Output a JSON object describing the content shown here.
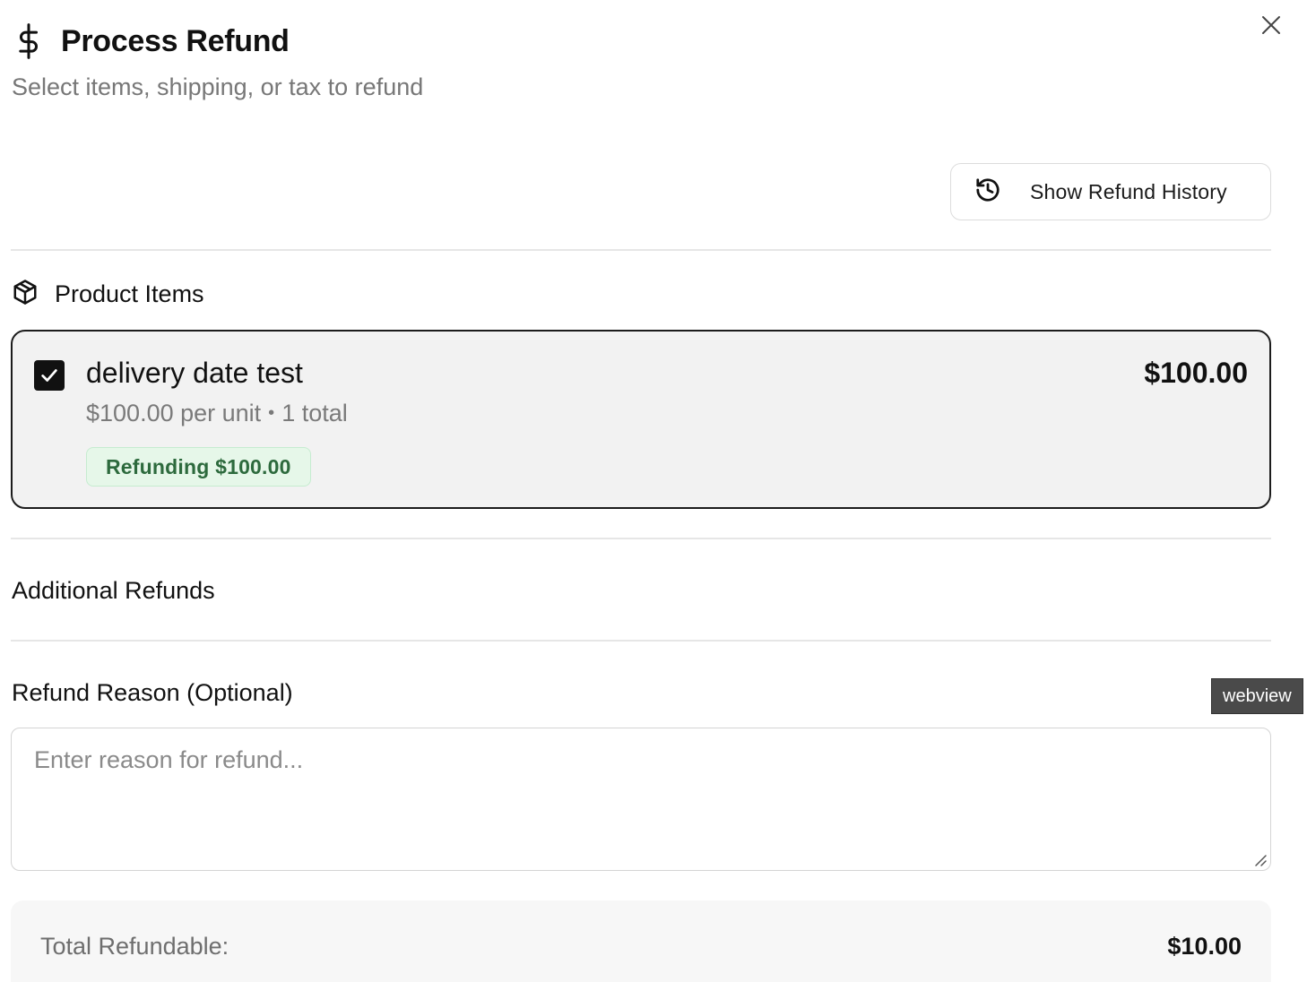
{
  "header": {
    "title": "Process Refund",
    "subtitle": "Select items, shipping, or tax to refund",
    "icon": "dollar-icon",
    "close_icon": "close-icon"
  },
  "history_button": {
    "label": "Show Refund History",
    "icon": "history-icon"
  },
  "product_items": {
    "heading": "Product Items",
    "icon": "package-icon",
    "items": [
      {
        "name": "delivery date test",
        "price": "$100.00",
        "unit_price": "$100.00 per unit",
        "separator": "•",
        "quantity": "1 total",
        "checked": true,
        "badge": "Refunding $100.00"
      }
    ]
  },
  "additional_refunds": {
    "heading": "Additional Refunds"
  },
  "reason": {
    "label": "Refund Reason (Optional)",
    "placeholder": "Enter reason for refund...",
    "value": ""
  },
  "tooltip": {
    "text": "webview"
  },
  "totals": {
    "label": "Total Refundable:",
    "value": "$10.00"
  },
  "colors": {
    "badge_bg": "#e6f7e9",
    "badge_text": "#2d6a3d",
    "card_bg": "#f2f2f2",
    "card_border": "#1c1c1c"
  }
}
